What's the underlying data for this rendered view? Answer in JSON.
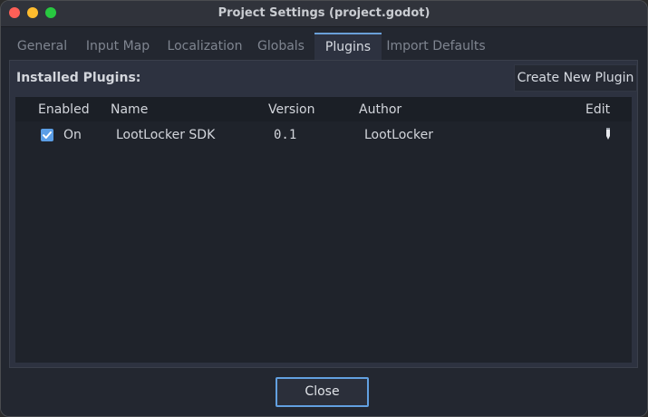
{
  "window": {
    "title": "Project Settings (project.godot)"
  },
  "tabs": [
    {
      "label": "General"
    },
    {
      "label": "Input Map"
    },
    {
      "label": "Localization"
    },
    {
      "label": "Globals"
    },
    {
      "label": "Plugins",
      "active": true
    },
    {
      "label": "Import Defaults"
    }
  ],
  "plugins": {
    "section_title": "Installed Plugins:",
    "create_button": "Create New Plugin",
    "columns": [
      "Enabled",
      "Name",
      "Version",
      "Author",
      "Edit"
    ],
    "rows": [
      {
        "enabled": true,
        "enabled_label": "On",
        "name": "LootLocker SDK",
        "version": "0.1",
        "author": "LootLocker",
        "edit_icon": "pencil-icon"
      }
    ]
  },
  "footer": {
    "close_label": "Close"
  },
  "colors": {
    "accent": "#62a0e0",
    "checkbox": "#5b9ee6"
  }
}
